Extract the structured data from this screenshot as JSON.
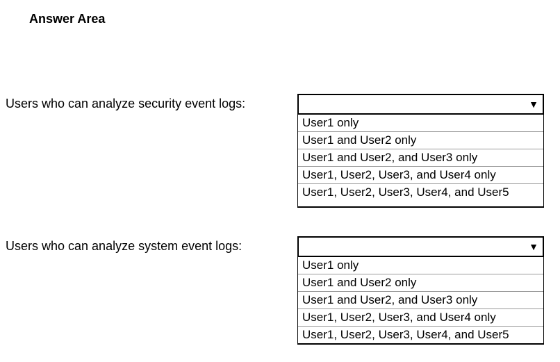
{
  "heading": "Answer Area",
  "question1": {
    "label": "Users who can analyze security event logs:",
    "options": [
      "User1 only",
      "User1 and User2 only",
      "User1 and User2, and User3 only",
      "User1, User2, User3, and User4 only",
      "User1, User2, User3, User4, and User5"
    ]
  },
  "question2": {
    "label": "Users who can analyze system event logs:",
    "options": [
      "User1 only",
      "User1 and User2 only",
      "User1 and User2, and User3 only",
      "User1, User2, User3, and User4 only",
      "User1, User2, User3, User4, and User5"
    ]
  }
}
